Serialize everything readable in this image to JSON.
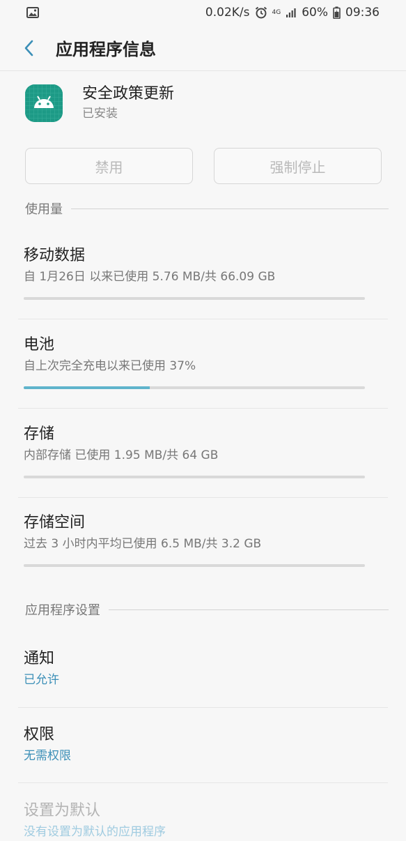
{
  "status_bar": {
    "net_speed": "0.02K/s",
    "network_type": "4G",
    "battery_percent": "60%",
    "time": "09:36",
    "icons": [
      "image-icon",
      "alarm-icon",
      "signal-icon",
      "battery-icon"
    ]
  },
  "header": {
    "title": "应用程序信息"
  },
  "app": {
    "name": "安全政策更新",
    "status": "已安装",
    "icon": "android-icon"
  },
  "buttons": {
    "disable": "禁用",
    "force_stop": "强制停止"
  },
  "usage": {
    "section_label": "使用量",
    "mobile_data": {
      "title": "移动数据",
      "detail": "自 1月26日 以来已使用 5.76 MB/共 66.09 GB",
      "progress": 0
    },
    "battery": {
      "title": "电池",
      "detail": "自上次完全充电以来已使用 37%",
      "progress": 0.37
    },
    "storage": {
      "title": "存储",
      "detail": "内部存储 已使用 1.95 MB/共 64 GB",
      "progress": 0
    },
    "memory": {
      "title": "存储空间",
      "detail": "过去 3 小时内平均已使用 6.5 MB/共 3.2 GB",
      "progress": 0
    }
  },
  "app_settings": {
    "section_label": "应用程序设置",
    "notifications": {
      "title": "通知",
      "value": "已允许"
    },
    "permissions": {
      "title": "权限",
      "value": "无需权限"
    },
    "set_default": {
      "title": "设置为默认",
      "value": "没有设置为默认的应用程序"
    }
  },
  "colors": {
    "accent": "#3b8fb7",
    "progress_fill": "#5fb4cc",
    "app_icon_bg": "#1d9a86"
  }
}
